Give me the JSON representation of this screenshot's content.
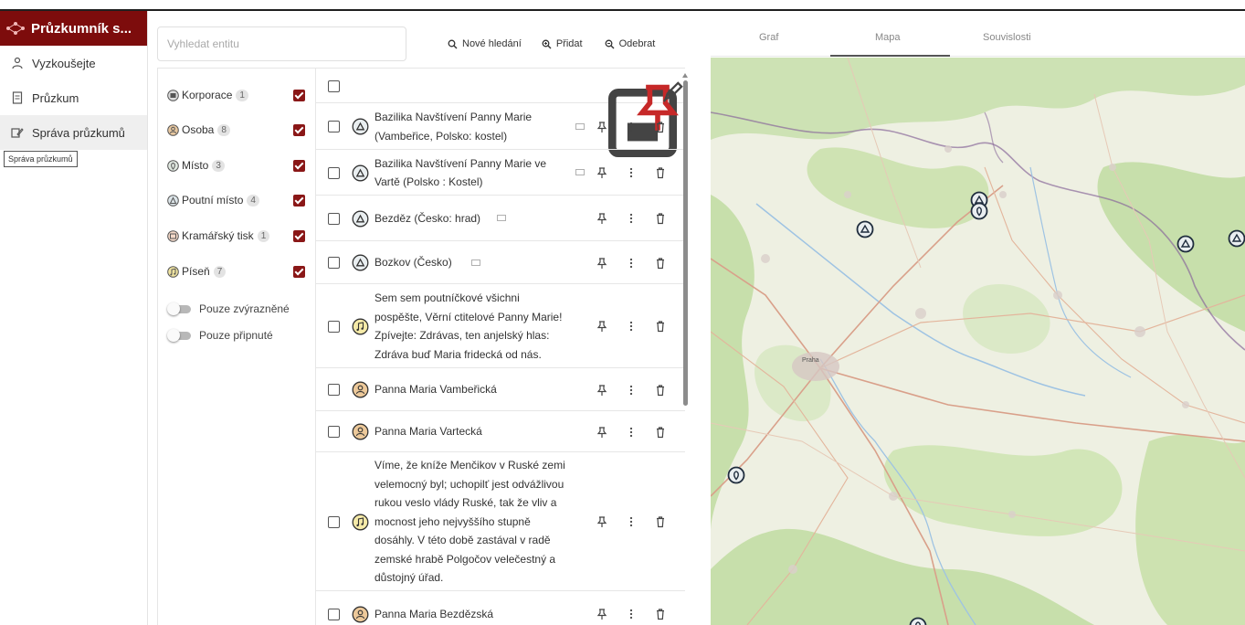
{
  "app": {
    "title": "Průzkumník s..."
  },
  "sidebar": {
    "items": [
      {
        "label": "Vyzkoušejte",
        "icon": "people-icon"
      },
      {
        "label": "Průzkum",
        "icon": "document-icon"
      },
      {
        "label": "Správa průzkumů",
        "icon": "manage-icon"
      }
    ],
    "tooltip": "Správa průzkumů"
  },
  "toolbar": {
    "search_placeholder": "Vyhledat entitu",
    "new_search": "Nové hledání",
    "add": "Přidat",
    "remove": "Odebrat"
  },
  "filters": {
    "types": [
      {
        "label": "Korporace",
        "count": "1",
        "checked": true,
        "icon": "corporation-icon"
      },
      {
        "label": "Osoba",
        "count": "8",
        "checked": true,
        "icon": "person-icon"
      },
      {
        "label": "Místo",
        "count": "3",
        "checked": true,
        "icon": "place-icon"
      },
      {
        "label": "Poutní místo",
        "count": "4",
        "checked": true,
        "icon": "pilgrimage-icon"
      },
      {
        "label": "Kramářský tisk",
        "count": "1",
        "checked": true,
        "icon": "print-icon"
      },
      {
        "label": "Píseň",
        "count": "7",
        "checked": true,
        "icon": "song-icon"
      }
    ],
    "toggles": [
      {
        "label": "Pouze zvýrazněné",
        "on": false
      },
      {
        "label": "Pouze připnuté",
        "on": false
      }
    ]
  },
  "entities": [
    {
      "lines": [
        "Bazilika Navštívení Panny Marie",
        "(Vambeřice, Polsko: kostel)"
      ],
      "type": "pilgrimage"
    },
    {
      "lines": [
        "Bazilika Navštívení Panny Marie ve",
        "Vartě (Polsko : Kostel)"
      ],
      "type": "pilgrimage"
    },
    {
      "lines": [
        "Bezděz (Česko: hrad)"
      ],
      "type": "pilgrimage"
    },
    {
      "lines": [
        "Bozkov (Česko)"
      ],
      "type": "pilgrimage"
    },
    {
      "lines": [
        "Sem sem poutníčkové všichni",
        "pospěšte, Věrní ctitelové Panny Marie!",
        "Zpívejte: Zdrávas, ten anjelský hlas:",
        "Zdráva buď Maria fridecká od nás."
      ],
      "type": "song"
    },
    {
      "lines": [
        "Panna Maria Vambeřická"
      ],
      "type": "person"
    },
    {
      "lines": [
        "Panna Maria Vartecká"
      ],
      "type": "person"
    },
    {
      "lines": [
        "Víme, že kníže Menčikov v Ruské zemi",
        "velemocný byl; uchopilť jest odvážlivou",
        "rukou veslo vlády Ruské, tak že vliv a",
        "mocnost jeho nejvyššího stupně",
        "dosáhly. V této době zastával v radě",
        "zemské hrabě Polgočov velečestný a",
        "důstojný úřad."
      ],
      "type": "song"
    },
    {
      "lines": [
        "Panna Maria Bezdězská"
      ],
      "type": "person"
    }
  ],
  "map_panel": {
    "tabs": [
      "Graf",
      "Mapa",
      "Souvislosti"
    ],
    "active_tab": "Mapa",
    "city_label": "Praha"
  },
  "colors": {
    "brand": "#7d0c0c",
    "checkbox_checked": "#8a1717",
    "pin_active": "#c62828",
    "map_base": "#eef0e2",
    "map_forest": "#c7dfab"
  }
}
